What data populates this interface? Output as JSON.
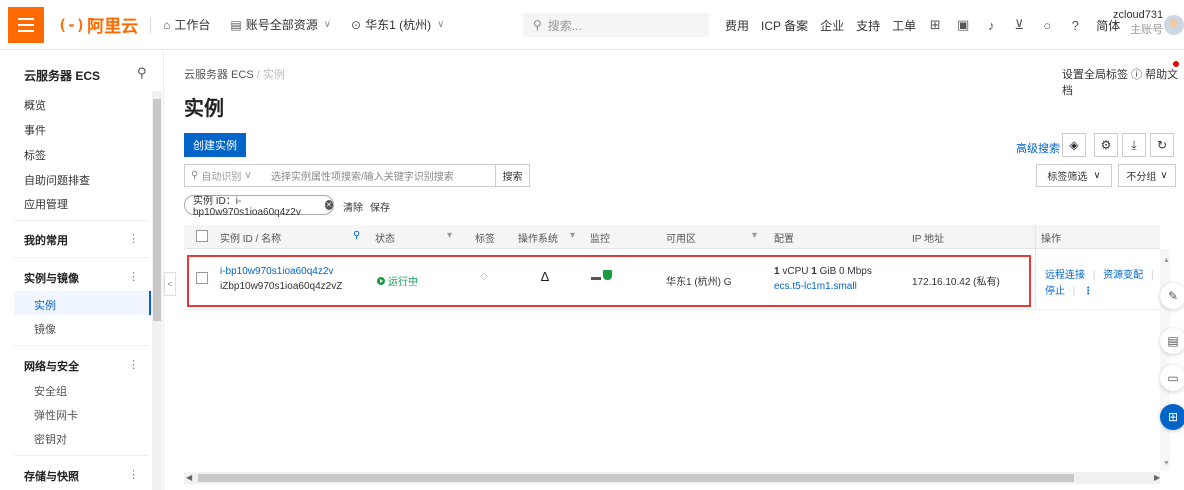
{
  "header": {
    "logo_mark": "(-)",
    "logo_text": "阿里云",
    "workbench": "工作台",
    "account_scope": "账号全部资源",
    "region": "华东1 (杭州)",
    "search_placeholder": "搜索...",
    "links": [
      "费用",
      "ICP 备案",
      "企业",
      "支持",
      "工单"
    ],
    "lang": "简体",
    "user_name": "zcloud731",
    "user_role": "主账号"
  },
  "sidebar": {
    "title": "云服务器 ECS",
    "top_items": [
      "概览",
      "事件",
      "标签",
      "自助问题排查",
      "应用管理"
    ],
    "groups": {
      "favorites": "我的常用",
      "instances_images": "实例与镜像",
      "network_security": "网络与安全",
      "storage": "存储与快照"
    },
    "sub_instance": "实例",
    "sub_image": "镜像",
    "network_items": [
      "安全组",
      "弹性网卡",
      "密钥对"
    ],
    "more": "⋮"
  },
  "main": {
    "breadcrumb_root": "云服务器 ECS",
    "breadcrumb_sep": "/",
    "breadcrumb_current": "实例",
    "top_link_tags": "设置全局标签",
    "top_link_help": "帮助文档",
    "title": "实例",
    "create_button": "创建实例",
    "advanced_search": "高级搜索",
    "search_auto": "自动识别",
    "search_placeholder": "选择实例属性项搜索/输入关键字识别搜索",
    "search_button": "搜索",
    "tag_filter": "标签筛选",
    "group_filter": "不分组",
    "chip": "实例 ID：i-bp10w970s1ioa60q4z2v",
    "chip_clear": "清除",
    "chip_save": "保存"
  },
  "table": {
    "headers": {
      "id": "实例 ID / 名称",
      "status": "状态",
      "tag": "标签",
      "os": "操作系统",
      "monitor": "监控",
      "zone": "可用区",
      "config": "配置",
      "ip": "IP 地址",
      "actions": "操作"
    },
    "row": {
      "id": "i-bp10w970s1ioa60q4z2v",
      "name": "iZbp10w970s1ioa60q4z2vZ",
      "status": "运行中",
      "zone": "华东1 (杭州) G",
      "config_vcpu": "1",
      "config_vcpu_unit": "vCPU",
      "config_mem": "1",
      "config_mem_unit": "GiB 0 Mbps",
      "config_type": "ecs.t5-lc1m1.small",
      "ip": "172.16.10.42 (私有)",
      "action_remote": "远程连接",
      "action_change": "资源变配",
      "action_stop": "停止",
      "action_more": "⋮"
    }
  },
  "colors": {
    "brand": "#ff6a00",
    "primary": "#0064c8",
    "running": "#1a9b40",
    "highlight": "#e53935"
  }
}
